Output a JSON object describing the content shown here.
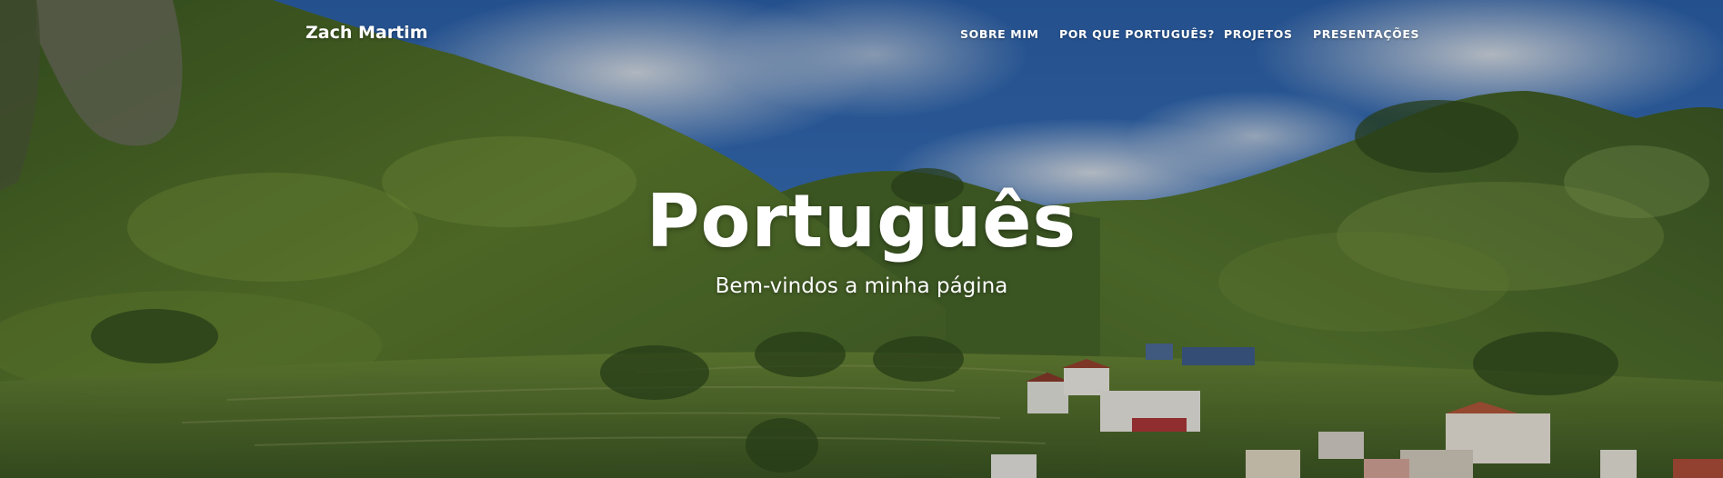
{
  "navbar": {
    "brand": "Zach Martim",
    "items": [
      {
        "label": "SOBRE MIM"
      },
      {
        "label": "POR QUE PORTUGUÊS?"
      },
      {
        "label": "PROJETOS"
      },
      {
        "label": "PRESENTAÇÕES"
      }
    ]
  },
  "hero": {
    "title": "Português",
    "subtitle": "Bem-vindos a minha página"
  },
  "colors": {
    "sky": "#2f67b3",
    "cloud": "#c9d3de",
    "mountain_dark": "#2f4a1c",
    "mountain_light": "#6f8e3a",
    "text": "#ffffff"
  }
}
